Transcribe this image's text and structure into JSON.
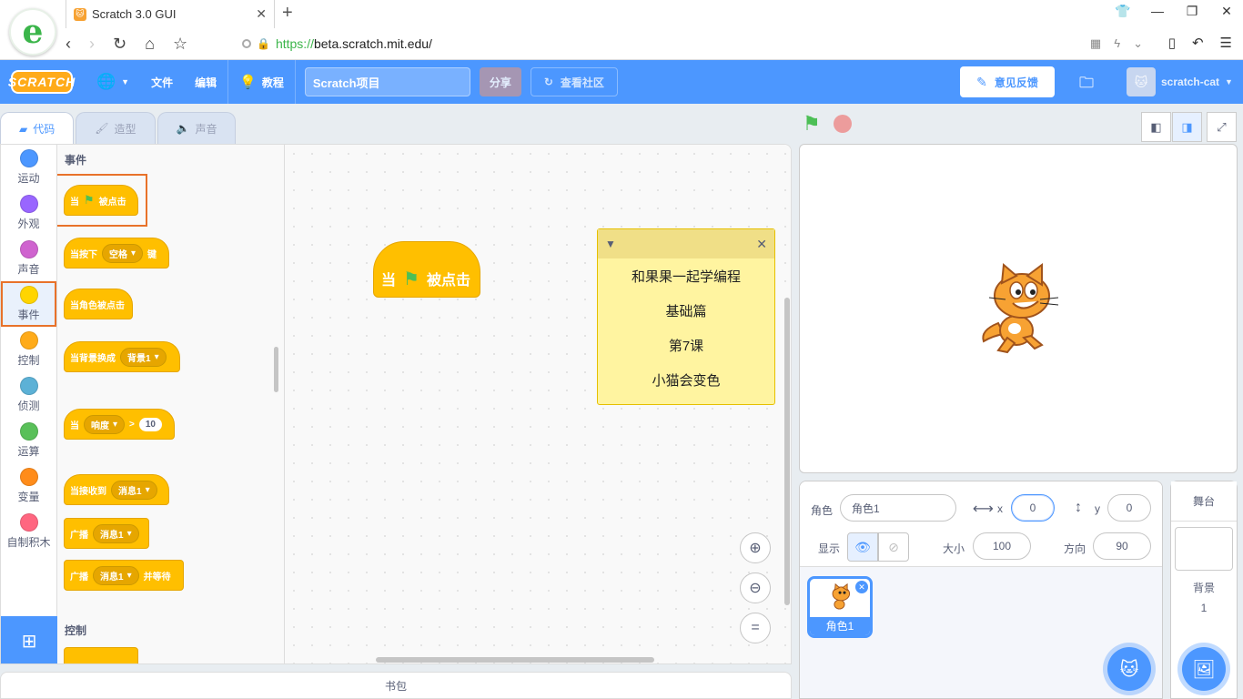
{
  "browser": {
    "tab_title": "Scratch 3.0 GUI",
    "url_scheme": "https://",
    "url_rest": "beta.scratch.mit.edu/"
  },
  "menubar": {
    "logo": "SCRATCH",
    "file": "文件",
    "edit": "编辑",
    "tutorials": "教程",
    "project_title": "Scratch项目",
    "share": "分享",
    "see_community": "查看社区",
    "feedback": "意见反馈",
    "username": "scratch-cat"
  },
  "editor_tabs": [
    {
      "label": "代码"
    },
    {
      "label": "造型"
    },
    {
      "label": "声音"
    }
  ],
  "categories": [
    {
      "label": "运动",
      "color": "#4c97ff"
    },
    {
      "label": "外观",
      "color": "#9966ff"
    },
    {
      "label": "声音",
      "color": "#cf63cf"
    },
    {
      "label": "事件",
      "color": "#ffd500"
    },
    {
      "label": "控制",
      "color": "#ffab19"
    },
    {
      "label": "侦测",
      "color": "#5cb1d6"
    },
    {
      "label": "运算",
      "color": "#59c059"
    },
    {
      "label": "变量",
      "color": "#ff8c1a"
    },
    {
      "label": "自制积木",
      "color": "#ff6680"
    }
  ],
  "palette": {
    "section_events": "事件",
    "b1_when": "当",
    "b1_clicked": "被点击",
    "b2_when": "当按下",
    "b2_key": "空格",
    "b2_suffix": "键",
    "b3": "当角色被点击",
    "b4": "当背景换成",
    "b4_backdrop": "背景1",
    "b5_when": "当",
    "b5_sensor": "响度",
    "b5_op": ">",
    "b5_value": "10",
    "b6": "当接收到",
    "b6_msg": "消息1",
    "b7": "广播",
    "b7_msg": "消息1",
    "b8": "广播",
    "b8_msg": "消息1",
    "b8_suffix": "并等待",
    "section_control": "控制"
  },
  "script": {
    "block_when": "当",
    "block_clicked": "被点击",
    "note_lines": [
      "和果果一起学编程",
      "基础篇",
      "第7课",
      "小猫会变色"
    ]
  },
  "backpack": "书包",
  "sprite_info": {
    "sprite_label": "角色",
    "sprite_name": "角色1",
    "x_label": "x",
    "x_value": "0",
    "y_label": "y",
    "y_value": "0",
    "show_label": "显示",
    "size_label": "大小",
    "size_value": "100",
    "direction_label": "方向",
    "direction_value": "90"
  },
  "sprites": [
    {
      "name": "角色1"
    }
  ],
  "stage_panel": {
    "title": "舞台",
    "backdrops_label": "背景",
    "backdrops_count": "1"
  }
}
